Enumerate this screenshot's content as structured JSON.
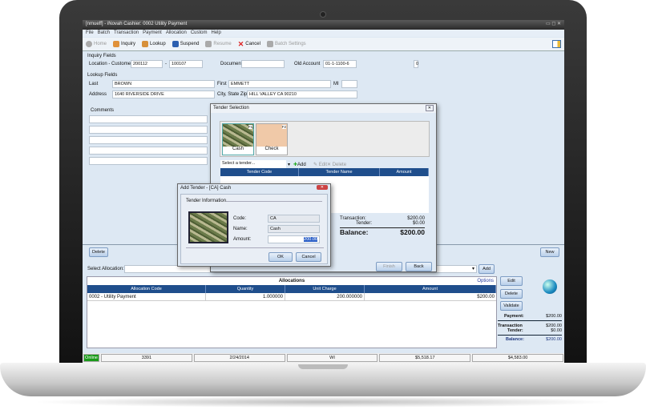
{
  "window": {
    "title": "[nmueff] - iNovah Cashier: 0002 Utility Payment"
  },
  "menu": [
    "File",
    "Batch",
    "Transaction",
    "Payment",
    "Allocation",
    "Custom",
    "Help"
  ],
  "toolbar": [
    {
      "label": "Home",
      "icon": "home-icon",
      "enabled": false
    },
    {
      "label": "Inquiry",
      "icon": "person-icon",
      "enabled": true
    },
    {
      "label": "Lookup",
      "icon": "person-search-icon",
      "enabled": true
    },
    {
      "label": "Suspend",
      "icon": "suspend-icon",
      "enabled": true
    },
    {
      "label": "Resume",
      "icon": "resume-icon",
      "enabled": false
    },
    {
      "label": "Cancel",
      "icon": "cancel-x-icon",
      "enabled": true
    },
    {
      "label": "Batch Settings",
      "icon": "gear-icon",
      "enabled": false
    }
  ],
  "inquiry": {
    "section": "Inquiry Fields",
    "location_label": "Location - Customer",
    "location": "200112",
    "dash": "-",
    "customer": "100107",
    "document_label": "Document",
    "document": "",
    "old_account_label": "Old Account",
    "old_account": "01-1-1100-6",
    "count": "0"
  },
  "lookup": {
    "section": "Lookup Fields",
    "last_label": "Last",
    "last": "BROWN",
    "first_label": "First",
    "first": "EMMETT",
    "mi_label": "MI",
    "mi": "",
    "address_label": "Address",
    "address": "1640 RIVERSIDE DRIVE",
    "csz_label": "City, State Zip",
    "csz": "HILL VALLEY CA 90210"
  },
  "comments": {
    "label": "Comments"
  },
  "tender_selection": {
    "title": "Tender Selection",
    "tiles": [
      {
        "key": "F1",
        "label": "Cash"
      },
      {
        "key": "F2",
        "label": "Check"
      }
    ],
    "select_placeholder": "Select a tender...",
    "add": "Add",
    "edit": "Edit",
    "delete": "Delete",
    "columns": [
      "Tender Code",
      "Tender Name",
      "Amount"
    ],
    "transaction_label": "Transaction:",
    "transaction": "$200.00",
    "tender_label": "Tender:",
    "tender": "$0.00",
    "balance_label": "Balance:",
    "balance": "$200.00",
    "finish": "Finish",
    "back": "Back"
  },
  "add_tender": {
    "title": "Add Tender - [CA] Cash",
    "section": "Tender Information",
    "code_label": "Code:",
    "code": "CA",
    "name_label": "Name:",
    "name": "Cash",
    "amount_label": "Amount:",
    "amount": "200.00",
    "ok": "OK",
    "cancel": "Cancel"
  },
  "main": {
    "delete": "Delete",
    "new": "New",
    "select_allocation_label": "Select Allocation:",
    "add": "Add",
    "allocations_title": "Allocations",
    "options": "Options",
    "columns": [
      "Allocation Code",
      "Quantity",
      "Unit Charge",
      "Amount"
    ],
    "rows": [
      [
        "0002 - Utility Payment",
        "1.000000",
        "200.000000",
        "$200.00"
      ]
    ],
    "edit": "Edit",
    "delete2": "Delete",
    "validate": "Validate",
    "payment_label": "Payment:",
    "payment": "$200.00",
    "transaction_label": "Transaction",
    "transaction": "$200.00",
    "tender_label": "Tender:",
    "tender": "$0.00",
    "balance_label": "Balance:",
    "balance": "$200.00"
  },
  "status": {
    "online": "Online",
    "cells": [
      "3391",
      "2/24/2014",
      "WI",
      "$5,518.17",
      "$4,583.00"
    ],
    "online_color": "#1a9a1a"
  }
}
